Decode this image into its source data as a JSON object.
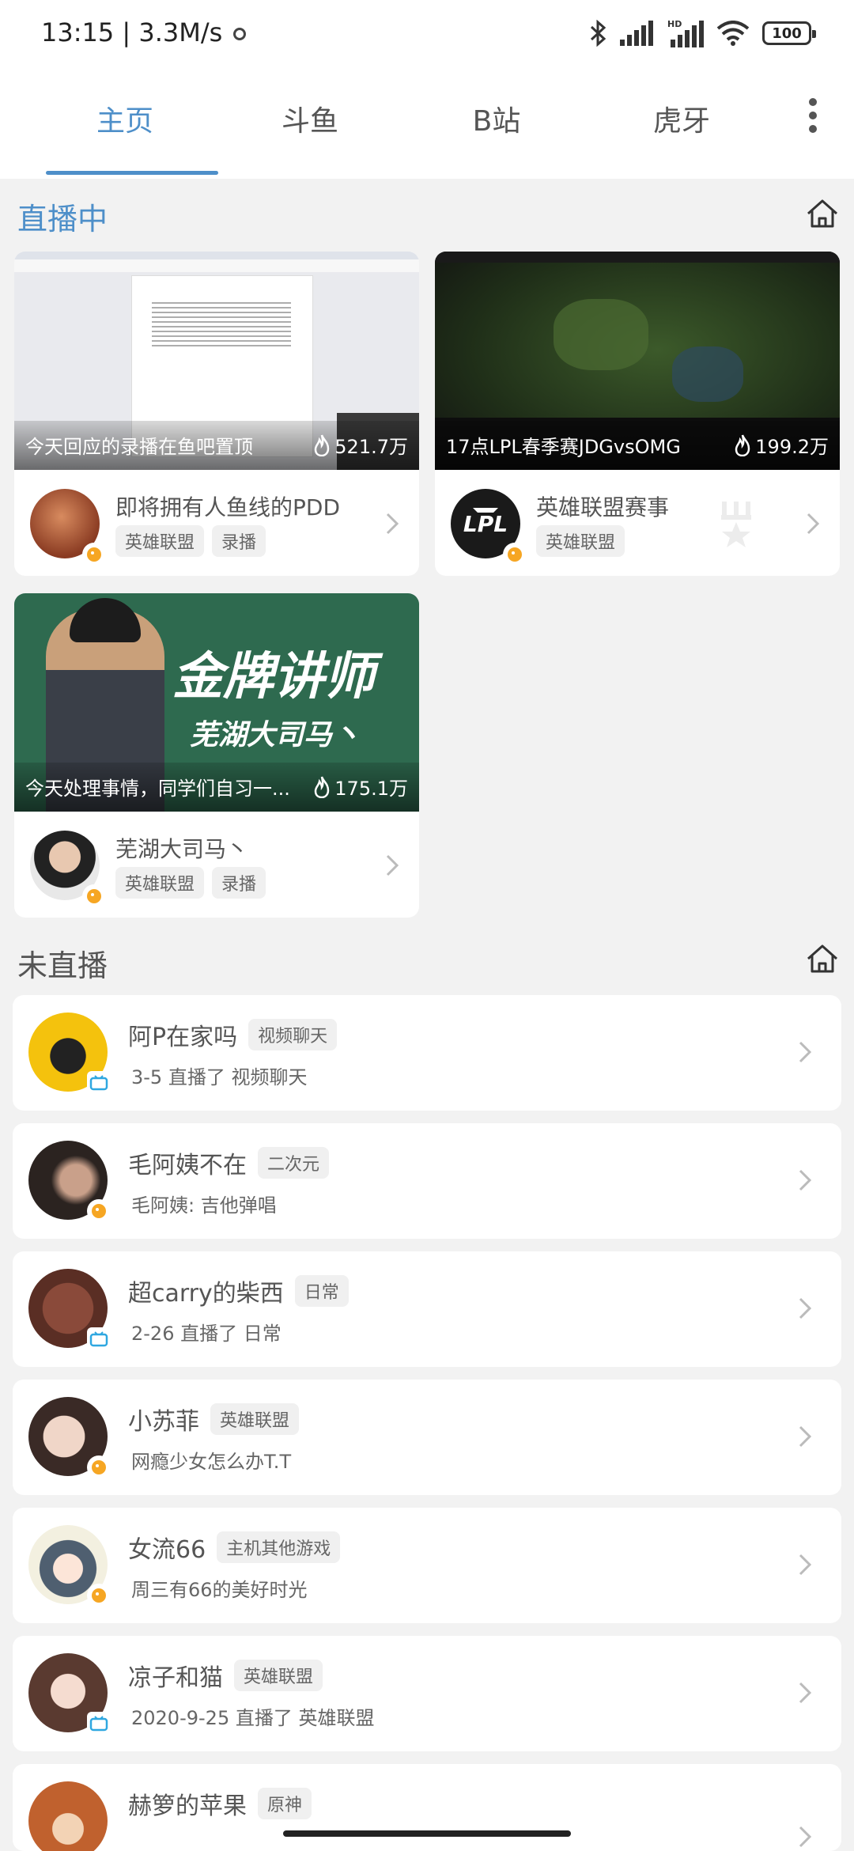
{
  "status_bar": {
    "time": "13:15 | 3.3M/s",
    "battery": "100"
  },
  "tabs": [
    "主页",
    "斗鱼",
    "B站",
    "虎牙"
  ],
  "live_section": {
    "title": "直播中",
    "cards": [
      {
        "thumb_title": "今天回应的录播在鱼吧置顶",
        "heat": "521.7万",
        "name": "即将拥有人鱼线的PDD",
        "tags": [
          "英雄联盟",
          "录播"
        ]
      },
      {
        "thumb_title": "17点LPL春季赛JDGvsOMG",
        "heat": "199.2万",
        "name": "英雄联盟赛事",
        "tags": [
          "英雄联盟"
        ]
      },
      {
        "thumb_title": "今天处理事情，同学们自习一...",
        "heat": "175.1万",
        "name": "芜湖大司马丶",
        "tags": [
          "英雄联盟",
          "录播"
        ],
        "thumb_text_big": "金牌讲师",
        "thumb_text_sub": "芜湖大司马丶"
      }
    ]
  },
  "offline_section": {
    "title": "未直播",
    "rows": [
      {
        "name": "阿P在家吗",
        "tag": "视频聊天",
        "sub": "3-5 直播了 视频聊天"
      },
      {
        "name": "毛阿姨不在",
        "tag": "二次元",
        "sub": "毛阿姨: 吉他弹唱"
      },
      {
        "name": "超carry的柴西",
        "tag": "日常",
        "sub": "2-26 直播了 日常"
      },
      {
        "name": "小苏菲",
        "tag": "英雄联盟",
        "sub": "网瘾少女怎么办T.T"
      },
      {
        "name": "女流66",
        "tag": "主机其他游戏",
        "sub": "周三有66的美好时光"
      },
      {
        "name": "凉子和猫",
        "tag": "英雄联盟",
        "sub": "2020-9-25 直播了 英雄联盟"
      },
      {
        "name": "赫箩的苹果",
        "tag": "原神",
        "sub": ""
      }
    ]
  },
  "colors": {
    "accent": "#4e8fc9",
    "background": "#f2f2f2"
  }
}
